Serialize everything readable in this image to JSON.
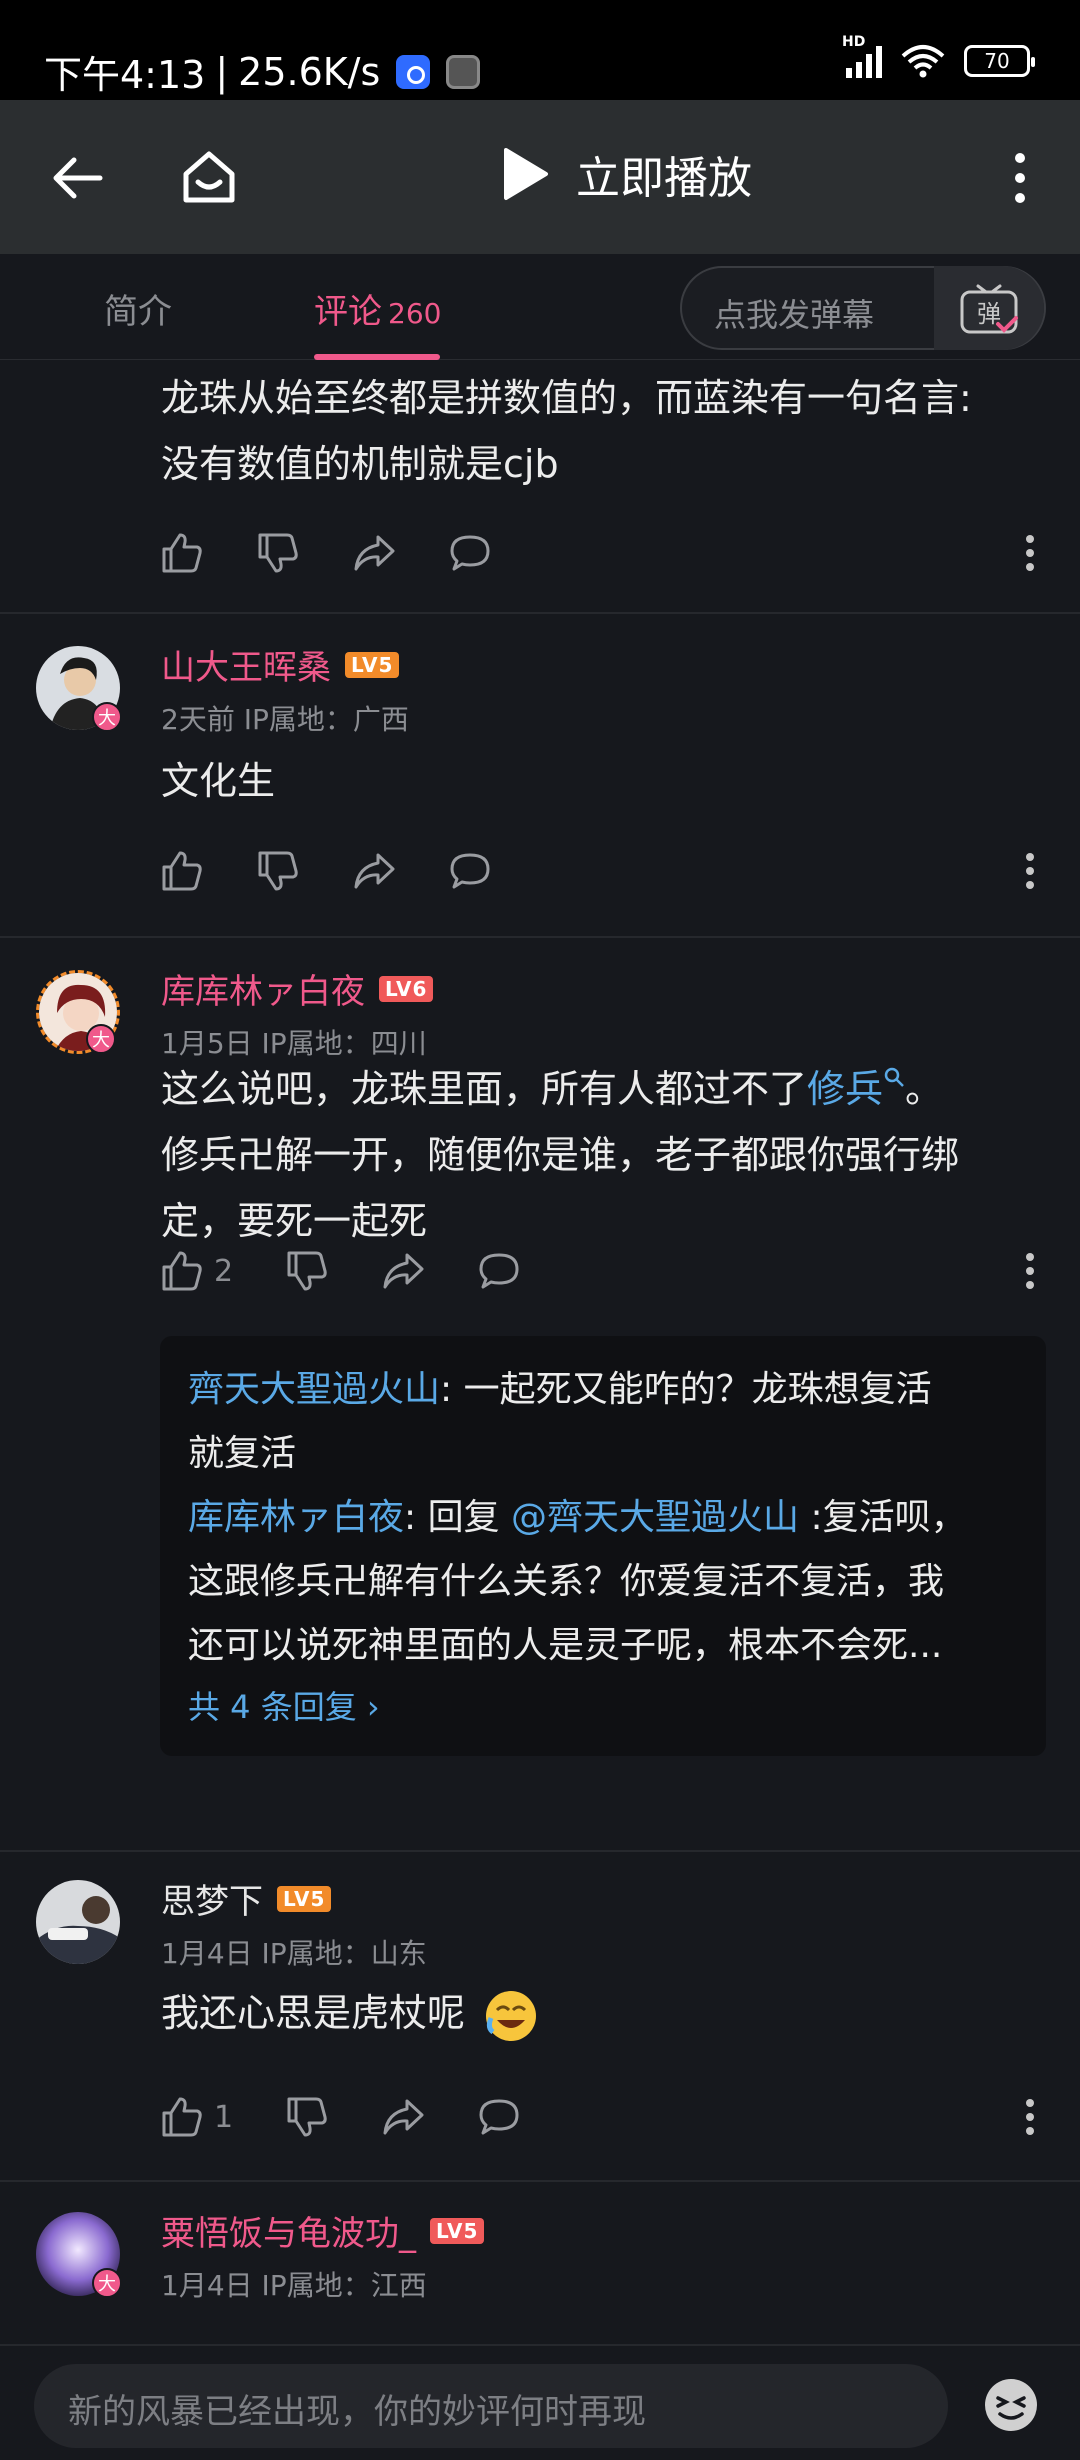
{
  "status_bar": {
    "time": "下午4:13",
    "speed": "25.6K/s",
    "hd": "HD",
    "battery": "70"
  },
  "header": {
    "title": "立即播放"
  },
  "tabs": {
    "intro": "简介",
    "comments": "评论",
    "comments_count": "260"
  },
  "danmaku": {
    "placeholder": "点我发弹幕",
    "button": "弹"
  },
  "colors": {
    "accent": "#f0598b",
    "link": "#5aa9e6",
    "background": "#16181d"
  },
  "comments": [
    {
      "text_line1": "龙珠从始至终都是拼数值的，而蓝染有一句名言:",
      "text_line2": "没有数值的机制就是cjb"
    },
    {
      "user": "山大王晖桑",
      "level": "LV5",
      "time": "2天前",
      "ip": "IP属地：广西",
      "text": "文化生",
      "badge": "大"
    },
    {
      "user": "库库林ァ白夜",
      "level": "LV6",
      "time": "1月5日",
      "ip": "IP属地：四川",
      "badge": "大",
      "text_line1_pre": "这么说吧，龙珠里面，所有人都过不了",
      "text_link": "修兵",
      "text_line1_post": "。",
      "text_line2": "修兵卍解一开，随便你是谁，老子都跟你强行绑",
      "text_line3": "定，要死一起死",
      "likes": "2",
      "replies": {
        "r1_name": "齊天大聖過火山",
        "r1_text_a": ": 一起死又能咋的？龙珠想复活",
        "r1_text_b": "就复活",
        "r2_name": "库库林ァ白夜",
        "r2_reply": ": 回复 ",
        "r2_at": "@齊天大聖過火山",
        "r2_text_a": " :复活呗，",
        "r2_text_b": "这跟修兵卍解有什么关系？你爱复活不复活，我",
        "r2_text_c": "还可以说死神里面的人是灵子呢，根本不会死...",
        "more": "共 4 条回复 ›"
      }
    },
    {
      "user": "思梦下",
      "level": "LV5",
      "time": "1月4日",
      "ip": "IP属地：山东",
      "text": "我还心思是虎杖呢",
      "likes": "1"
    },
    {
      "user": "粟悟饭与龟波功_",
      "level": "LV5",
      "time": "1月4日",
      "ip": "IP属地：江西",
      "badge": "大"
    }
  ],
  "input": {
    "placeholder": "新的风暴已经出现，你的妙评何时再现"
  }
}
